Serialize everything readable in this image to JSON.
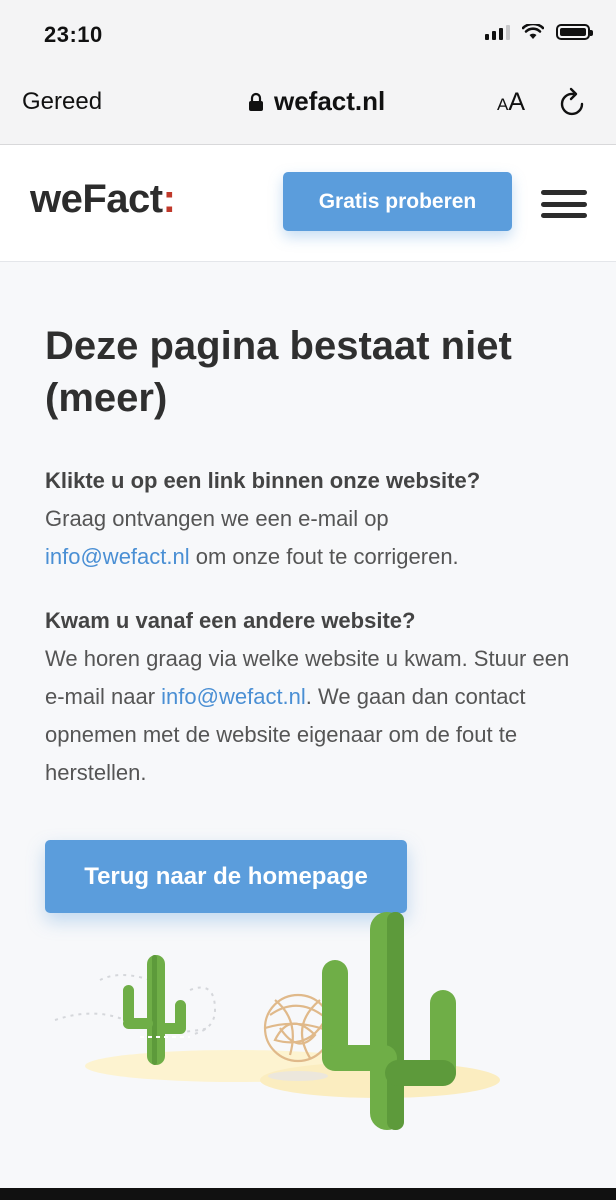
{
  "status_bar": {
    "time": "23:10"
  },
  "browser": {
    "done_label": "Gereed",
    "url": "wefact.nl",
    "aa_small": "A",
    "aa_big": "A"
  },
  "header": {
    "logo_text": "weFact",
    "logo_colon": ":",
    "cta_label": "Gratis proberen"
  },
  "main": {
    "title": "Deze pagina bestaat niet (meer)",
    "p1_bold": "Klikte u op een link binnen onze website?",
    "p1_text_a": "Graag ontvangen we een e-mail op",
    "p1_link": "info@wefact.nl",
    "p1_text_b": "om onze fout te corrigeren.",
    "p2_bold": "Kwam u vanaf een andere website?",
    "p2_text_a": "We horen graag via welke website u kwam. Stuur een e-mail naar",
    "p2_link": "info@wefact.nl",
    "p2_text_b": ". We gaan dan contact opnemen met de website eigenaar om de fout te herstellen.",
    "home_button": "Terug naar de homepage"
  },
  "colors": {
    "accent": "#5b9ddc",
    "link": "#4a8fd4",
    "logo_colon": "#c0392b",
    "cactus": "#6fae47",
    "sand": "#fdf3d0"
  },
  "icons": [
    "lock-icon",
    "reload-icon",
    "menu-icon",
    "cactus-icon",
    "tumbleweed-icon"
  ]
}
